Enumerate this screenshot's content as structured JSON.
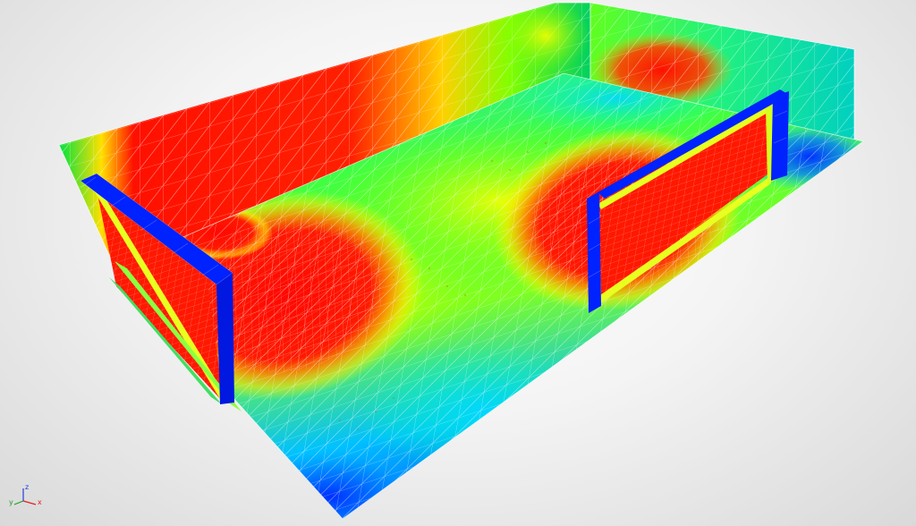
{
  "viewport": {
    "background": "#ececec"
  },
  "colormap": {
    "stops": [
      "#0000ff",
      "#00c8ff",
      "#00ff40",
      "#ffff00",
      "#ff0000"
    ]
  },
  "frame_color": "#0022ff",
  "mesh_color": "#ffffff",
  "axes": {
    "x_label": "x",
    "y_label": "y",
    "z_label": "z",
    "x_color": "#e02020",
    "y_color": "#20a020",
    "z_color": "#2040e0",
    "icon": "axis-triad-icon"
  }
}
